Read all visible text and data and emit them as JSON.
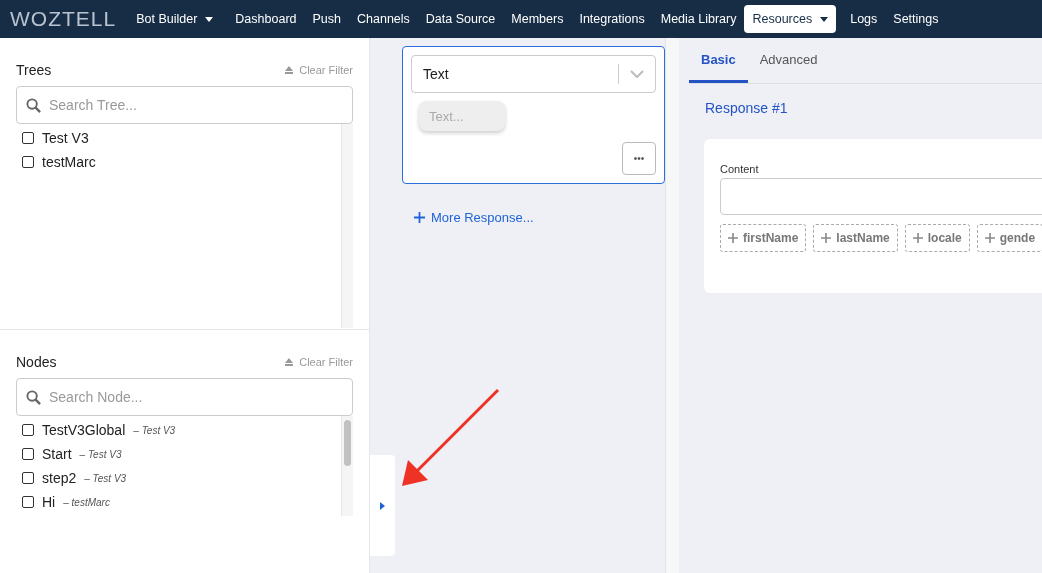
{
  "nav": {
    "logo": "WOZTELL",
    "items": [
      {
        "label": "Bot Builder",
        "selected": false,
        "has_menu": true
      },
      {
        "label": "Dashboard",
        "selected": false,
        "has_menu": false
      },
      {
        "label": "Push",
        "selected": false,
        "has_menu": false
      },
      {
        "label": "Channels",
        "selected": false,
        "has_menu": false
      },
      {
        "label": "Data Source",
        "selected": false,
        "has_menu": false
      },
      {
        "label": "Members",
        "selected": false,
        "has_menu": false
      },
      {
        "label": "Integrations",
        "selected": false,
        "has_menu": false
      },
      {
        "label": "Media Library",
        "selected": false,
        "has_menu": false
      },
      {
        "label": "Resources",
        "selected": true,
        "has_menu": true
      },
      {
        "label": "Logs",
        "selected": false,
        "has_menu": false
      },
      {
        "label": "Settings",
        "selected": false,
        "has_menu": false
      }
    ]
  },
  "trees": {
    "title": "Trees",
    "clear_filter": "Clear Filter",
    "search": {
      "placeholder": "Search Tree..."
    },
    "items": [
      {
        "label": "Test V3",
        "checked": false
      },
      {
        "label": "testMarc",
        "checked": false
      }
    ]
  },
  "nodes": {
    "title": "Nodes",
    "separator": "–",
    "clear_filter": "Clear Filter",
    "search": {
      "placeholder": "Search Node..."
    },
    "items": [
      {
        "label": "TestV3Global",
        "tree": "Test V3",
        "checked": false
      },
      {
        "label": "Start",
        "tree": "Test V3",
        "checked": false
      },
      {
        "label": "step2",
        "tree": "Test V3",
        "checked": false
      },
      {
        "label": "Hi",
        "tree": "testMarc",
        "checked": false
      }
    ]
  },
  "response_card": {
    "type_select": "Text",
    "text_placeholder": "Text...",
    "more_button": "•••"
  },
  "more_response": "More Response...",
  "tabs": [
    {
      "label": "Basic",
      "selected": true
    },
    {
      "label": "Advanced",
      "selected": false
    }
  ],
  "response_title": "Response #1",
  "content": {
    "label": "Content",
    "chips": [
      "firstName",
      "lastName",
      "locale",
      "gende"
    ]
  }
}
